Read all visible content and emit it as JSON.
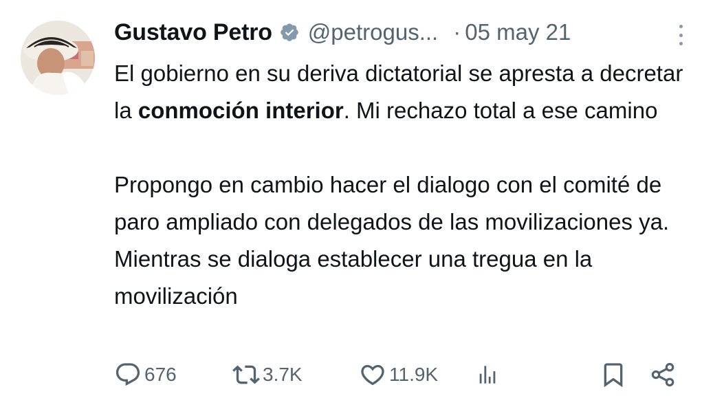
{
  "author": {
    "display_name": "Gustavo Petro",
    "handle": "@petrogus...",
    "verified_icon": "verified-badge-icon",
    "avatar_icon": "avatar-photo"
  },
  "meta": {
    "separator": "·",
    "date": "05 may 21"
  },
  "tweet": {
    "p1_before": "El gobierno en su deriva dictatorial se apresta a decretar la ",
    "p1_bold": "conmoción interior",
    "p1_after": ". Mi rechazo total a ese camino",
    "p2": "Propongo en cambio hacer el dialogo con el comité de paro ampliado con delegados de las movilizaciones ya. Mientras se dialoga establecer una tregua en la movilización"
  },
  "actions": {
    "replies": "676",
    "retweets": "3.7K",
    "likes": "11.9K"
  },
  "colors": {
    "text": "#0f1419",
    "secondary": "#536471",
    "verified_badge": "#829aab"
  }
}
